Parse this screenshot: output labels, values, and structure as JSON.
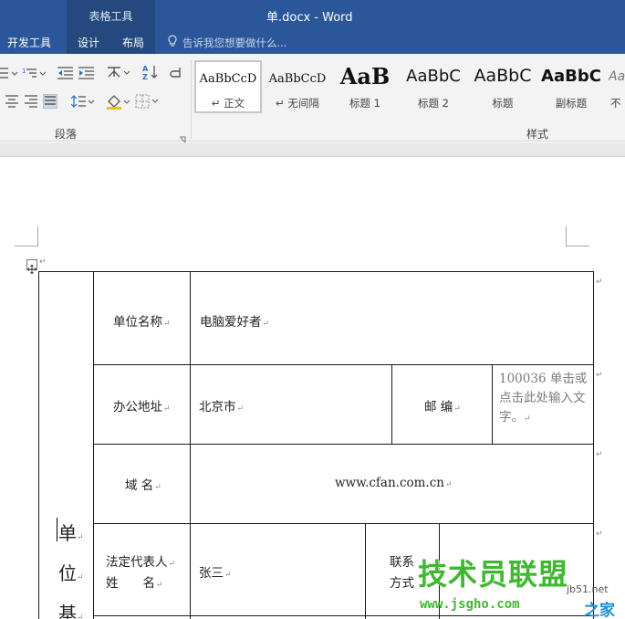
{
  "window": {
    "context_group": "表格工具",
    "title": "单.docx - Word",
    "accent": "#2b579a"
  },
  "tabs": [
    {
      "label": "开发工具"
    },
    {
      "label": "设计"
    },
    {
      "label": "布局"
    }
  ],
  "tell_me": {
    "text": "告诉我您想要做什么..."
  },
  "ribbon": {
    "paragraph_group": "段落",
    "styles_group": "样式",
    "styles": [
      {
        "sample": "AaBbCcD",
        "name": "正文",
        "active": true
      },
      {
        "sample": "AaBbCcD",
        "name": "无间隔"
      },
      {
        "sample": "AaB",
        "name": "标题 1"
      },
      {
        "sample": "AaBbC",
        "name": "标题 2"
      },
      {
        "sample": "AaBbC",
        "name": "标题"
      },
      {
        "sample": "AaBbC",
        "name": "副标题"
      },
      {
        "sample": "Aa",
        "name": "不"
      }
    ]
  },
  "table": {
    "side_header_chars": [
      "单",
      "位",
      "基"
    ],
    "rows": {
      "unit_name_label": "单位名称",
      "unit_name_value": "电脑爱好者",
      "address_label": "办公地址",
      "address_value": "北京市",
      "postcode_label": "邮 编",
      "postcode_value": "100036 单击或点击此处输入文字。",
      "domain_label": "域 名",
      "domain_value": "www.cfan.com.cn",
      "legal_rep_label_1": "法定代表人",
      "legal_rep_label_2": "姓　　名",
      "legal_rep_value": "张三",
      "contact_label_1": "联系",
      "contact_label_2": "方式"
    }
  },
  "watermark": {
    "main": "技术员联盟",
    "url": "www.jsgho.com",
    "site": "jb51.net",
    "suffix": "之家"
  }
}
